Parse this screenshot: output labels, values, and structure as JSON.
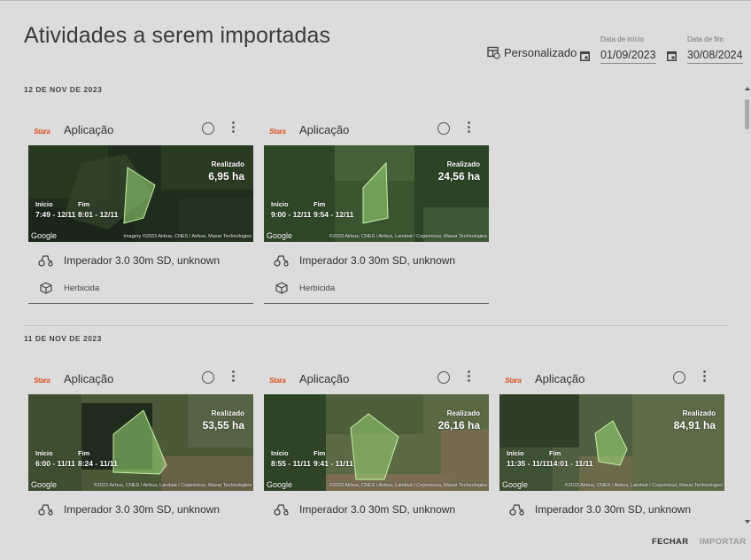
{
  "dialog": {
    "title": "Atividades a serem importadas",
    "period_label": "Personalizado",
    "start_label": "Data de início",
    "start_value": "01/09/2023",
    "end_label": "Data de fim",
    "end_value": "30/08/2024"
  },
  "groups": [
    {
      "date": "12 DE NOV DE 2023",
      "cards": [
        {
          "brand": "Stara",
          "title": "Aplicação",
          "realized_label": "Realizado",
          "area": "6,95 ha",
          "start_label": "Início",
          "start": "7:49 - 12/11",
          "end_label": "Fim",
          "end": "8:01 - 12/11",
          "google": "Google",
          "attribution": "Imagery ©2023 Airbus, CNES / Airbus, Maxar Technologies",
          "machine": "Imperador 3.0 30m SD, unknown",
          "product": "Herbicida"
        },
        {
          "brand": "Stara",
          "title": "Aplicação",
          "realized_label": "Realizado",
          "area": "24,56 ha",
          "start_label": "Início",
          "start": "9:00 - 12/11",
          "end_label": "Fim",
          "end": "9:54 - 12/11",
          "google": "Google",
          "attribution": "©2023 Airbus, CNES / Airbus, Landsat / Copernicus, Maxar Technologies",
          "machine": "Imperador 3.0 30m SD, unknown",
          "product": "Herbicida"
        }
      ]
    },
    {
      "date": "11 DE NOV DE 2023",
      "cards": [
        {
          "brand": "Stara",
          "title": "Aplicação",
          "realized_label": "Realizado",
          "area": "53,55 ha",
          "start_label": "Início",
          "start": "6:00 - 11/11",
          "end_label": "Fim",
          "end": "8:24 - 11/11",
          "google": "Google",
          "attribution": "©2023 Airbus, CNES / Airbus, Landsat / Copernicus, Maxar Technologies",
          "machine": "Imperador 3.0 30m SD, unknown"
        },
        {
          "brand": "Stara",
          "title": "Aplicação",
          "realized_label": "Realizado",
          "area": "26,16 ha",
          "start_label": "Início",
          "start": "8:55 - 11/11",
          "end_label": "Fim",
          "end": "9:41 - 11/11",
          "google": "Google",
          "attribution": "©2023 Airbus, CNES / Airbus, Landsat / Copernicus, Maxar Technologies",
          "machine": "Imperador 3.0 30m SD, unknown"
        },
        {
          "brand": "Stara",
          "title": "Aplicação",
          "realized_label": "Realizado",
          "area": "84,91 ha",
          "start_label": "Início",
          "start": "11:35 - 11/11",
          "end_label": "Fim",
          "end": "14:01 - 11/11",
          "google": "Google",
          "attribution": "©2023 Airbus, CNES / Airbus, Landsat / Copernicus, Maxar Technologies",
          "machine": "Imperador 3.0 30m SD, unknown"
        }
      ]
    }
  ],
  "footer": {
    "close": "FECHAR",
    "import": "IMPORTAR"
  },
  "colors": {
    "background": "#dcdcdc",
    "brand": "#d9531e",
    "polygon": "#9fdc7a"
  }
}
